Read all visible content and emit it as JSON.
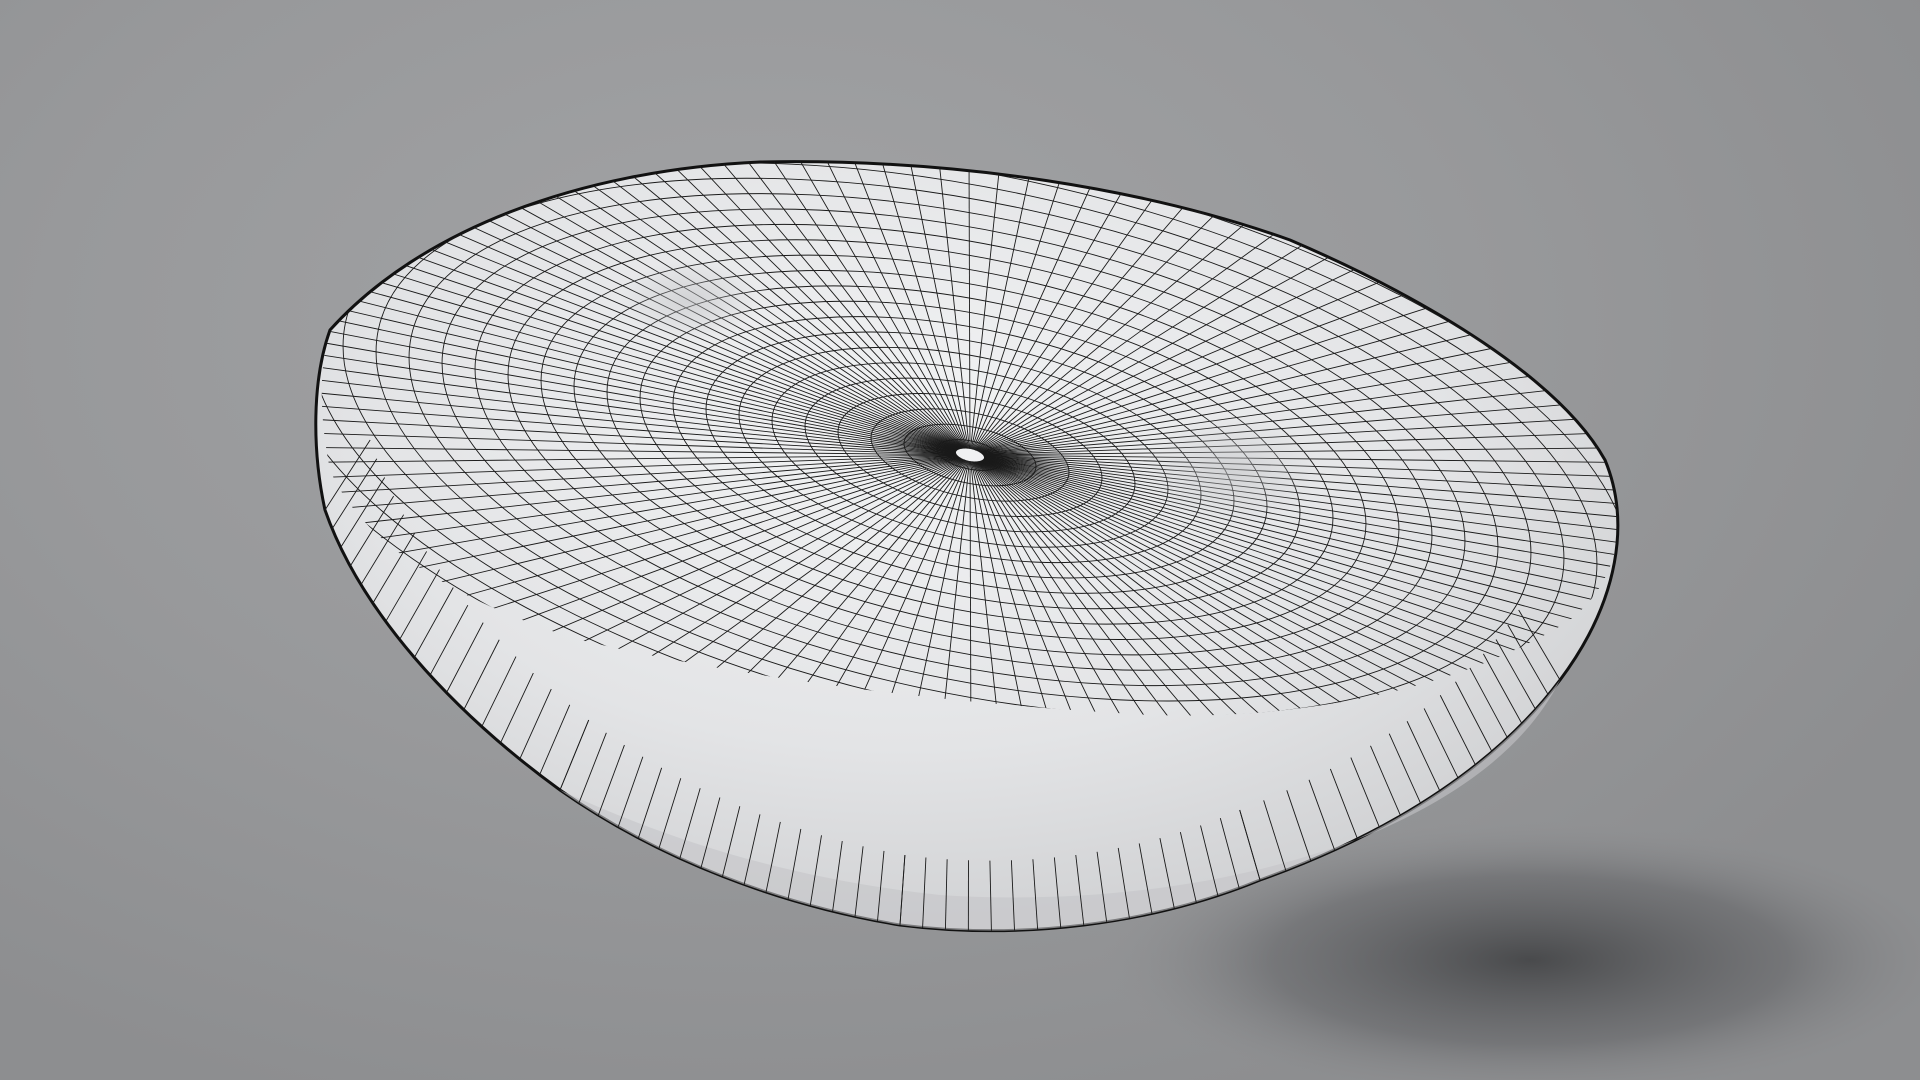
{
  "scene": {
    "subject": "beret",
    "display_mode": "wireframe-on-shaded",
    "background_color": "#98999b",
    "mesh_color": "#e6e7e9",
    "wire_color": "#1a1a1a",
    "shadow_color": "#3d3e40"
  }
}
